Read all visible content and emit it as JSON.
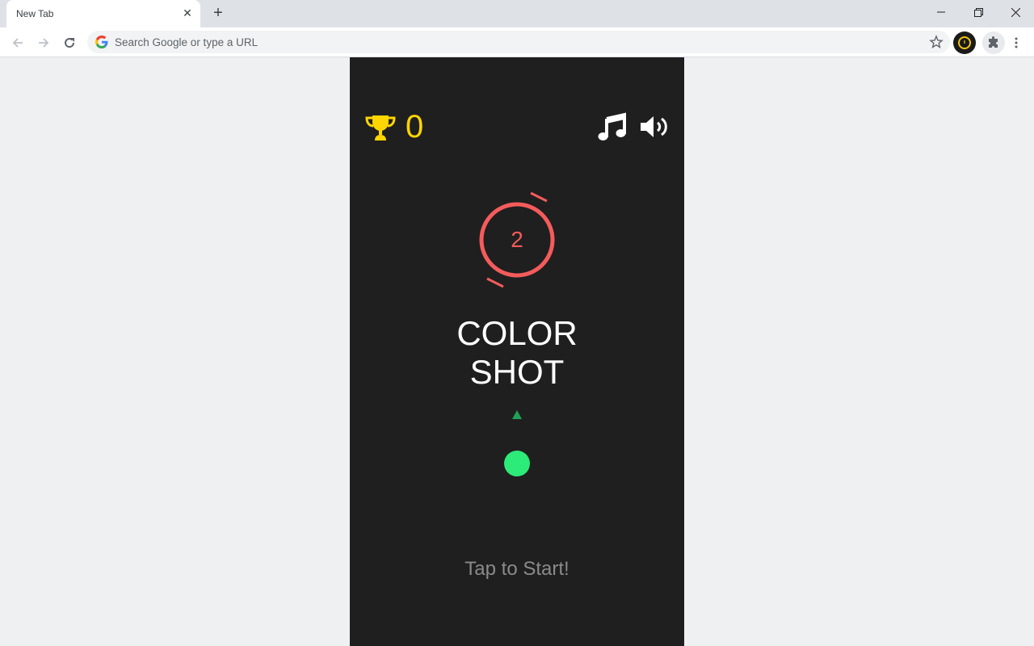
{
  "browser": {
    "tab_title": "New Tab",
    "close_tab_glyph": "✕",
    "new_tab_glyph": "+",
    "omnibox_placeholder": "Search Google or type a URL"
  },
  "game": {
    "best_score": "0",
    "level": "2",
    "title_line1": "COLOR",
    "title_line2": "SHOT",
    "tap_prompt": "Tap to Start!",
    "colors": {
      "background": "#1f1f1f",
      "score": "#ffd500",
      "ring": "#f55b5b",
      "ball": "#2ceb78",
      "arrow": "#20a055"
    }
  }
}
